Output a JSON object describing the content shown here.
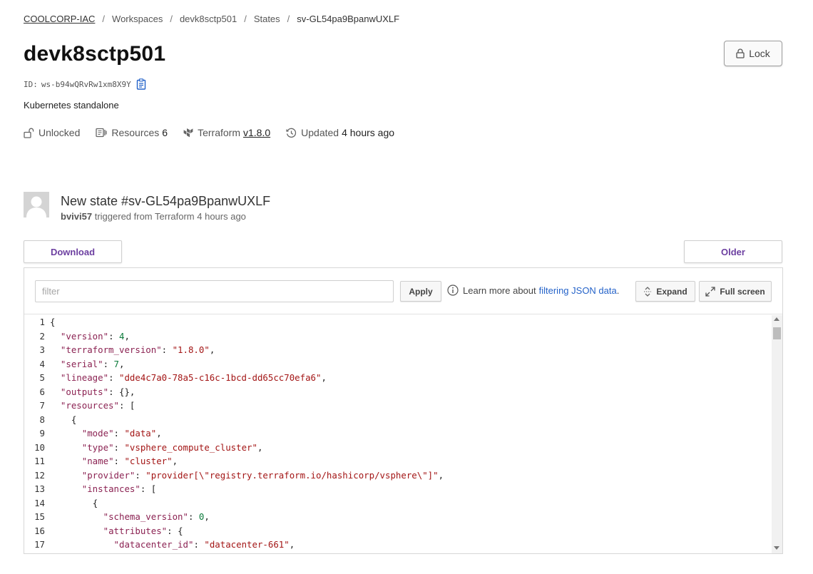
{
  "breadcrumb": {
    "org": "COOLCORP-IAC",
    "workspaces": "Workspaces",
    "workspace": "devk8sctp501",
    "states": "States",
    "current": "sv-GL54pa9BpanwUXLF",
    "separator": "/"
  },
  "page": {
    "title": "devk8sctp501",
    "lock_button": "Lock",
    "id_label": "ID:",
    "id_value": "ws-b94wQRvRw1xm8X9Y",
    "description": "Kubernetes standalone"
  },
  "meta": {
    "lock_status": "Unlocked",
    "resources_label": "Resources",
    "resources_count": "6",
    "terraform_label": "Terraform",
    "terraform_version": "v1.8.0",
    "updated_label": "Updated",
    "updated_value": "4 hours ago"
  },
  "state": {
    "title": "New state #sv-GL54pa9BpanwUXLF",
    "user": "bvivi57",
    "triggered_text": "triggered from Terraform 4 hours ago",
    "download_button": "Download",
    "older_button": "Older"
  },
  "toolbar": {
    "filter_placeholder": "filter",
    "apply_button": "Apply",
    "info_text": "Learn more about",
    "info_link": "filtering JSON data",
    "info_suffix": ".",
    "expand_button": "Expand",
    "fullscreen_button": "Full screen"
  },
  "code_lines": [
    {
      "n": "1",
      "indent": "",
      "key": "",
      "value": "{",
      "type": "p",
      "suffix": ""
    },
    {
      "n": "2",
      "indent": "  ",
      "key": "\"version\"",
      "value": "4",
      "type": "n",
      "suffix": ","
    },
    {
      "n": "3",
      "indent": "  ",
      "key": "\"terraform_version\"",
      "value": "\"1.8.0\"",
      "type": "s",
      "suffix": ","
    },
    {
      "n": "4",
      "indent": "  ",
      "key": "\"serial\"",
      "value": "7",
      "type": "n",
      "suffix": ","
    },
    {
      "n": "5",
      "indent": "  ",
      "key": "\"lineage\"",
      "value": "\"dde4c7a0-78a5-c16c-1bcd-dd65cc70efa6\"",
      "type": "s",
      "suffix": ","
    },
    {
      "n": "6",
      "indent": "  ",
      "key": "\"outputs\"",
      "value": "{}",
      "type": "p",
      "suffix": ","
    },
    {
      "n": "7",
      "indent": "  ",
      "key": "\"resources\"",
      "value": "[",
      "type": "p",
      "suffix": ""
    },
    {
      "n": "8",
      "indent": "    ",
      "key": "",
      "value": "{",
      "type": "p",
      "suffix": ""
    },
    {
      "n": "9",
      "indent": "      ",
      "key": "\"mode\"",
      "value": "\"data\"",
      "type": "s",
      "suffix": ","
    },
    {
      "n": "10",
      "indent": "      ",
      "key": "\"type\"",
      "value": "\"vsphere_compute_cluster\"",
      "type": "s",
      "suffix": ","
    },
    {
      "n": "11",
      "indent": "      ",
      "key": "\"name\"",
      "value": "\"cluster\"",
      "type": "s",
      "suffix": ","
    },
    {
      "n": "12",
      "indent": "      ",
      "key": "\"provider\"",
      "value": "\"provider[\\\"registry.terraform.io/hashicorp/vsphere\\\"]\"",
      "type": "s",
      "suffix": ","
    },
    {
      "n": "13",
      "indent": "      ",
      "key": "\"instances\"",
      "value": "[",
      "type": "p",
      "suffix": ""
    },
    {
      "n": "14",
      "indent": "        ",
      "key": "",
      "value": "{",
      "type": "p",
      "suffix": ""
    },
    {
      "n": "15",
      "indent": "          ",
      "key": "\"schema_version\"",
      "value": "0",
      "type": "n",
      "suffix": ","
    },
    {
      "n": "16",
      "indent": "          ",
      "key": "\"attributes\"",
      "value": "{",
      "type": "p",
      "suffix": ""
    },
    {
      "n": "17",
      "indent": "            ",
      "key": "\"datacenter_id\"",
      "value": "\"datacenter-661\"",
      "type": "s",
      "suffix": ","
    }
  ]
}
